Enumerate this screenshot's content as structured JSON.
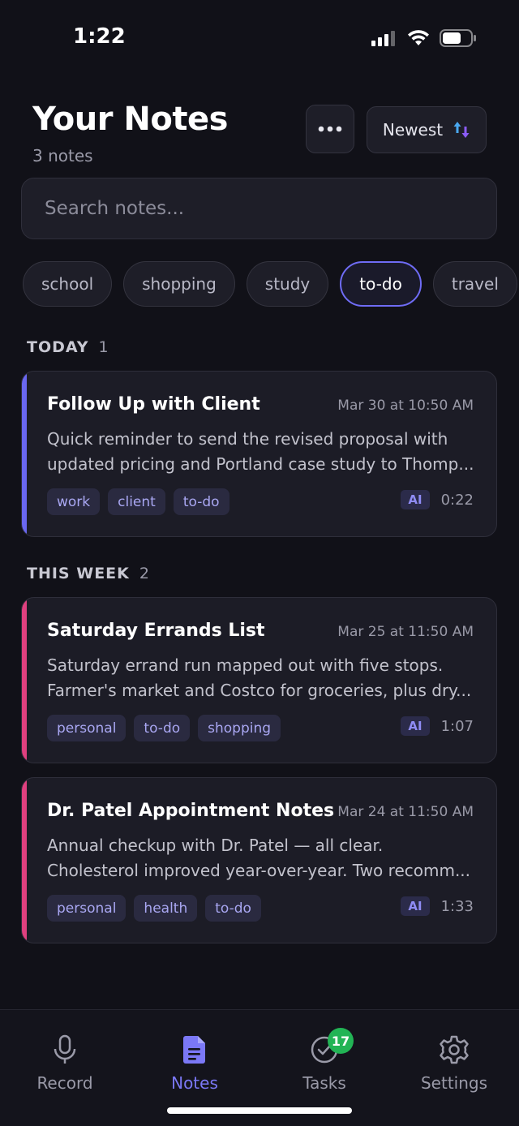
{
  "status_bar": {
    "time": "1:22"
  },
  "header": {
    "title": "Your Notes",
    "count": "3 notes",
    "sort_label": "Newest"
  },
  "search": {
    "placeholder": "Search notes..."
  },
  "filters": [
    {
      "label": "school",
      "active": false
    },
    {
      "label": "shopping",
      "active": false
    },
    {
      "label": "study",
      "active": false
    },
    {
      "label": "to-do",
      "active": true
    },
    {
      "label": "travel",
      "active": false
    }
  ],
  "sections": [
    {
      "label": "TODAY",
      "count": "1"
    },
    {
      "label": "THIS WEEK",
      "count": "2"
    }
  ],
  "notes": [
    {
      "title": "Follow Up with Client",
      "date": "Mar 30 at 10:50 AM",
      "preview_line1": "Quick reminder to send the revised proposal with",
      "preview_line2": "updated pricing and Portland case study to Thomp...",
      "tags": [
        "work",
        "client",
        "to-do"
      ],
      "ai": "AI",
      "duration": "0:22",
      "accent": "#6a67f0"
    },
    {
      "title": "Saturday Errands List",
      "date": "Mar 25 at 11:50 AM",
      "preview_line1": "Saturday errand run mapped out with five stops.",
      "preview_line2": "Farmer's market and Costco for groceries, plus dry...",
      "tags": [
        "personal",
        "to-do",
        "shopping"
      ],
      "ai": "AI",
      "duration": "1:07",
      "accent": "#e0407f"
    },
    {
      "title": "Dr. Patel Appointment Notes",
      "date": "Mar 24 at 11:50 AM",
      "preview_line1": "Annual checkup with Dr. Patel — all clear.",
      "preview_line2": "Cholesterol improved year-over-year. Two recomm...",
      "tags": [
        "personal",
        "health",
        "to-do"
      ],
      "ai": "AI",
      "duration": "1:33",
      "accent": "#e0407f"
    }
  ],
  "tabs": [
    {
      "label": "Record",
      "icon": "microphone-icon",
      "active": false
    },
    {
      "label": "Notes",
      "icon": "document-icon",
      "active": true
    },
    {
      "label": "Tasks",
      "icon": "check-circle-icon",
      "active": false,
      "badge": "17"
    },
    {
      "label": "Settings",
      "icon": "gear-icon",
      "active": false
    }
  ]
}
